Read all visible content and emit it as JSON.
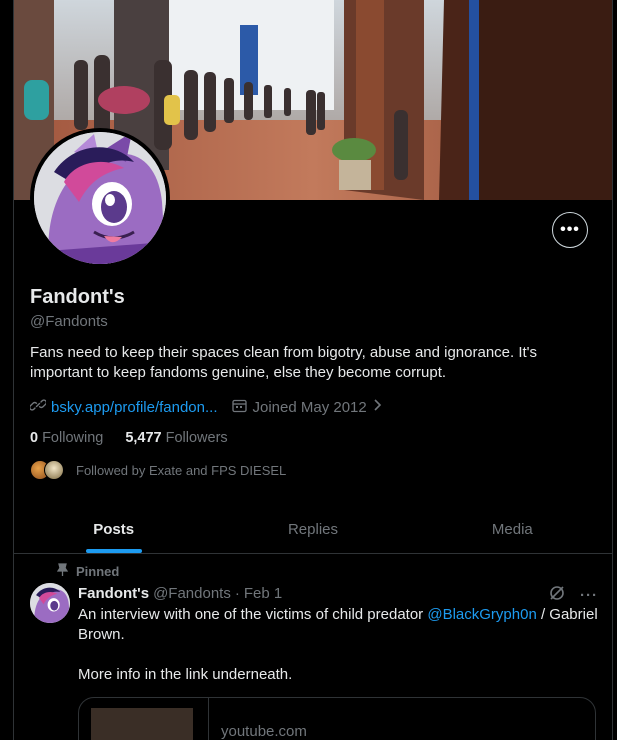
{
  "profile": {
    "display_name": "Fandont's",
    "handle": "@Fandonts",
    "bio": "Fans need to keep their spaces clean from bigotry, abuse and ignorance. It's important to keep fandoms genuine, else they become corrupt.",
    "link": "bsky.app/profile/fandon...",
    "joined": "Joined May 2012",
    "following_count": "0",
    "following_label": "Following",
    "followers_count": "5,477",
    "followers_label": "Followers",
    "followed_by": "Followed by Exate and FPS DIESEL",
    "more_label": "•••"
  },
  "tabs": [
    {
      "label": "Posts",
      "active": true
    },
    {
      "label": "Replies",
      "active": false
    },
    {
      "label": "Media",
      "active": false
    }
  ],
  "post": {
    "pinned_label": "Pinned",
    "author_name": "Fandont's",
    "author_handle": "@Fandonts",
    "separator": "·",
    "date": "Feb 1",
    "text_before": "An interview with one of the victims of child predator ",
    "mention": "@BlackGryph0n",
    "text_after": " / Gabriel Brown.",
    "text_line2": "More info in the link underneath.",
    "more_label": "···",
    "card_domain": "youtube.com"
  },
  "colors": {
    "background": "#000000",
    "accent": "#1d9bf0",
    "muted": "#71767b",
    "text": "#e7e9ea",
    "border": "#2f3336"
  },
  "icons": {
    "link": "link-icon",
    "calendar": "calendar-icon",
    "chevron": "chevron-right-icon",
    "pin": "pin-icon",
    "grok": "grok-icon",
    "more": "more-icon"
  }
}
